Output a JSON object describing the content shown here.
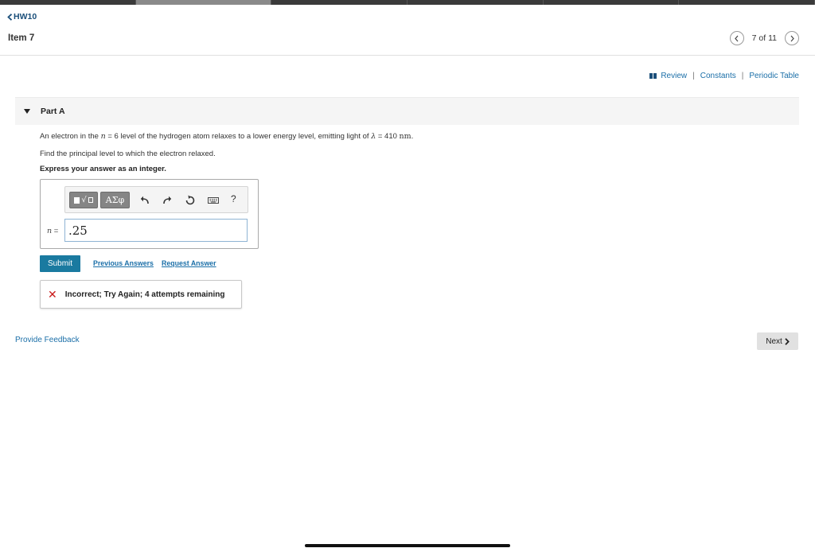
{
  "nav": {
    "back_label": "HW10",
    "item_title": "Item 7",
    "pager_text": "7 of 11"
  },
  "resources": {
    "review": "Review",
    "constants": "Constants",
    "periodic_table": "Periodic Table",
    "separator": "|"
  },
  "part": {
    "label": "Part A"
  },
  "question": {
    "text_1": "An electron in the",
    "n_symbol": "n",
    "text_2": "= 6 level of the hydrogen atom relaxes to a lower energy level, emitting light of",
    "lambda_symbol": "λ",
    "text_3": "= 410",
    "unit": "nm",
    "period": ".",
    "instruction": "Find the principal level to which the electron relaxed.",
    "express": "Express your answer as an integer."
  },
  "answer": {
    "label_symbol": "n",
    "label_eq": "=",
    "value": ".25",
    "greek_button": "ΑΣφ",
    "help": "?"
  },
  "actions": {
    "submit": "Submit",
    "previous_answers": "Previous Answers",
    "request_answer": "Request Answer"
  },
  "feedback": {
    "icon": "✕",
    "message": "Incorrect; Try Again; 4 attempts remaining"
  },
  "footer": {
    "provide_feedback": "Provide Feedback",
    "next": "Next"
  },
  "colors": {
    "link": "#1b6fa8",
    "submit_bg": "#1a7aa0",
    "error": "#c91a1a"
  }
}
